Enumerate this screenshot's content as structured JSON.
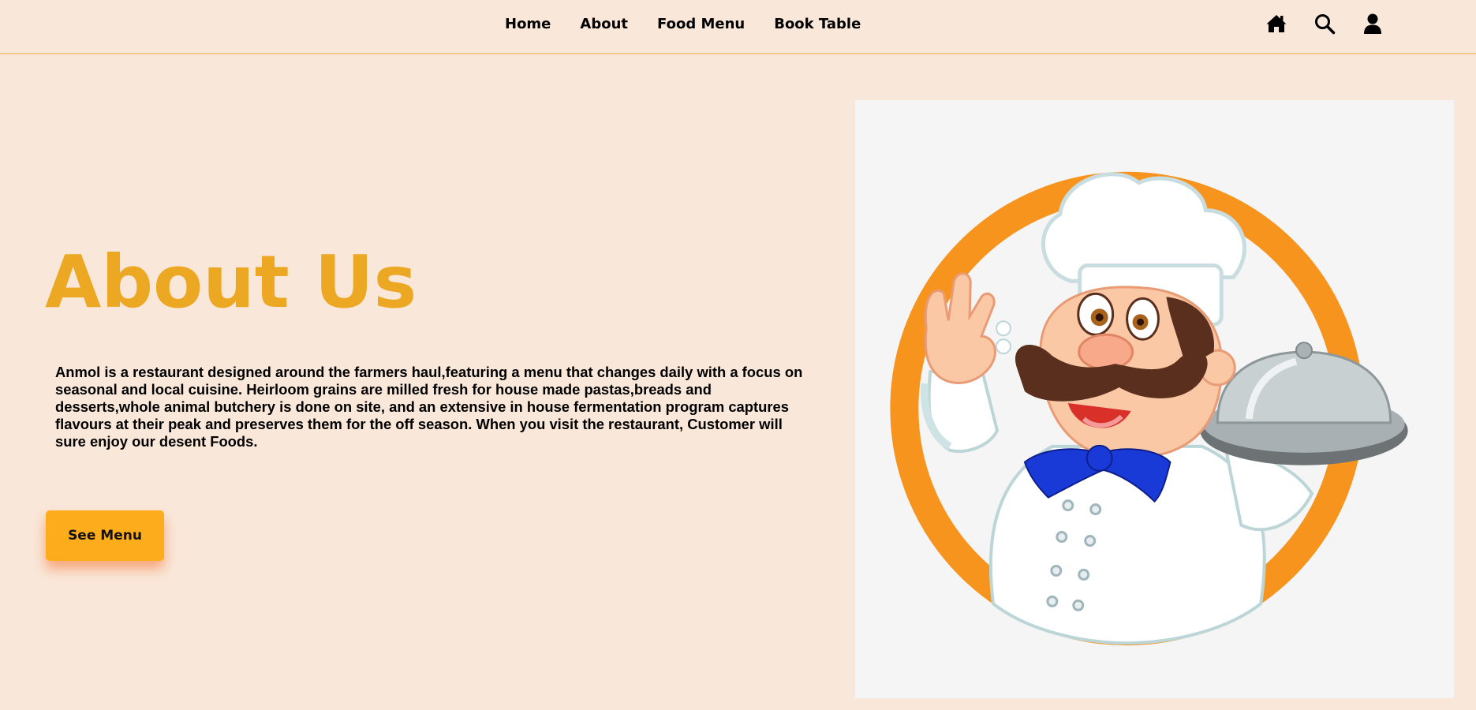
{
  "nav": {
    "links": [
      "Home",
      "About",
      "Food Menu",
      "Book Table"
    ],
    "icons": [
      "home-icon",
      "search-icon",
      "user-icon"
    ]
  },
  "about": {
    "title": "About Us",
    "description": "Anmol is a restaurant designed around the farmers haul,featuring a menu that changes daily with a focus on seasonal and local cuisine. Heirloom grains are milled fresh for house made pastas,breads and desserts,whole animal butchery is done on site, and an extensive in house fermentation program captures flavours at their peak and preserves them for the off season. When you visit the restaurant, Customer will sure enjoy our desent Foods.",
    "button_label": "See Menu"
  },
  "colors": {
    "background": "#f9e8da",
    "title": "#eca823",
    "button": "#fdad1c",
    "ring": "#f7941d",
    "scarf": "#1a3ad8"
  }
}
